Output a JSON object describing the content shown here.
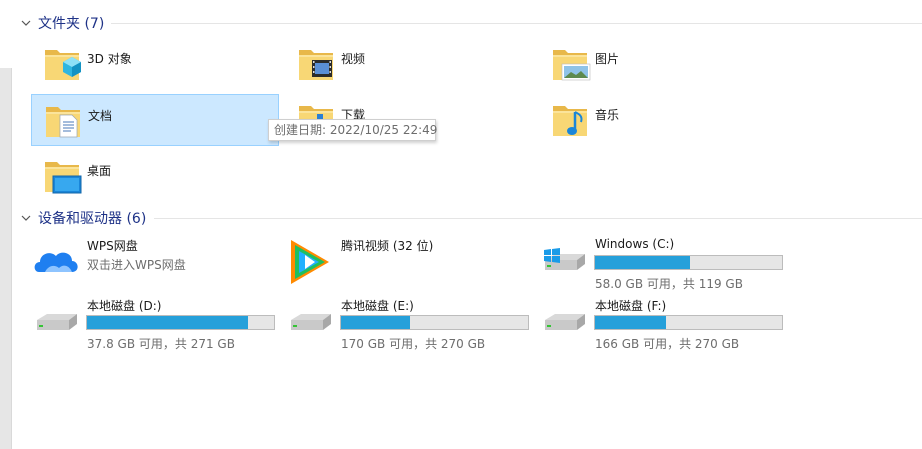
{
  "folders_group": {
    "title": "文件夹 (7)"
  },
  "folders": [
    {
      "label": "3D 对象",
      "icon": "folder-3d-objects-icon"
    },
    {
      "label": "视频",
      "icon": "folder-videos-icon"
    },
    {
      "label": "图片",
      "icon": "folder-pictures-icon"
    },
    {
      "label": "文档",
      "icon": "folder-documents-icon",
      "selected": true
    },
    {
      "label": "下载",
      "icon": "folder-downloads-icon"
    },
    {
      "label": "音乐",
      "icon": "folder-music-icon"
    },
    {
      "label": "桌面",
      "icon": "folder-desktop-icon"
    }
  ],
  "tooltip": {
    "text": "创建日期: 2022/10/25 22:49"
  },
  "devices_group": {
    "title": "设备和驱动器 (6)"
  },
  "devices": {
    "wps": {
      "name": "WPS网盘",
      "sub": "双击进入WPS网盘",
      "icon": "wps-cloud-icon"
    },
    "tencent": {
      "name": "腾讯视频 (32 位)",
      "icon": "tencent-video-icon"
    },
    "c": {
      "name": "Windows (C:)",
      "free": "58.0 GB 可用，共 119 GB",
      "used_fraction": 0.51,
      "icon": "windows-drive-icon"
    },
    "d": {
      "name": "本地磁盘 (D:)",
      "free": "37.8 GB 可用，共 271 GB",
      "used_fraction": 0.86,
      "icon": "hard-drive-icon"
    },
    "e": {
      "name": "本地磁盘 (E:)",
      "free": "170 GB 可用，共 270 GB",
      "used_fraction": 0.37,
      "icon": "hard-drive-icon"
    },
    "f": {
      "name": "本地磁盘 (F:)",
      "free": "166 GB 可用，共 270 GB",
      "used_fraction": 0.38,
      "icon": "hard-drive-icon"
    }
  },
  "colors": {
    "header_text": "#1e3287",
    "selection_bg": "#cce8ff",
    "selection_border": "#99d1ff",
    "usage_bar": "#26a0da"
  }
}
